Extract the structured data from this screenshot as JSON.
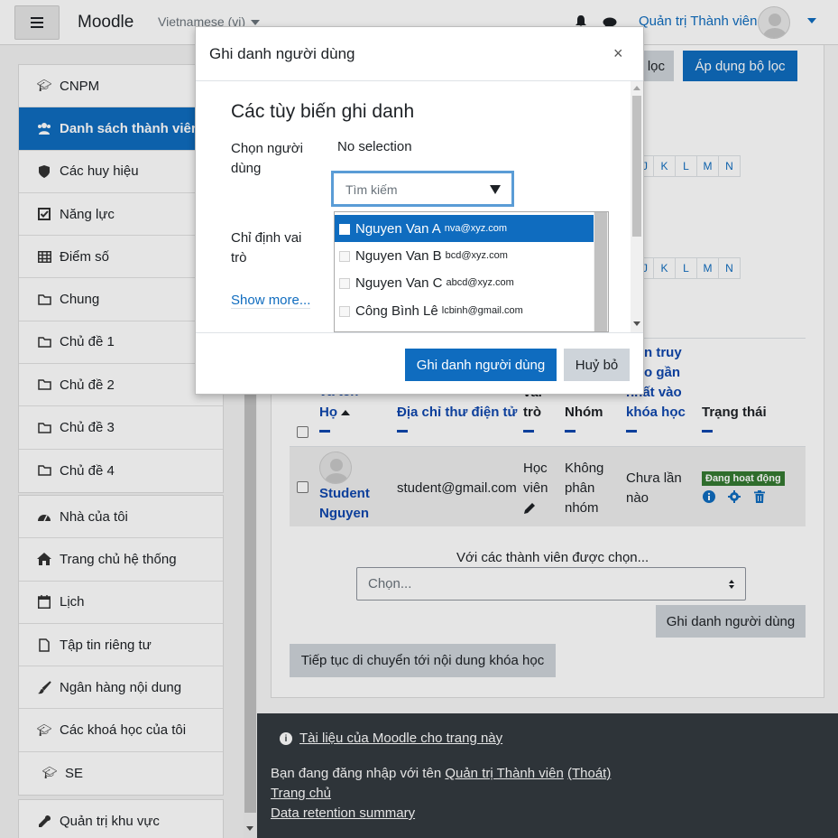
{
  "navbar": {
    "brand": "Moodle",
    "language": "Vietnamese (vi)",
    "user_name": "Quản trị Thành viên"
  },
  "sidebar": {
    "group1": [
      {
        "label": "CNPM",
        "icon": "graduation-cap-icon"
      },
      {
        "label": "Danh sách thành viên",
        "icon": "users-icon",
        "active": true
      },
      {
        "label": "Các huy hiệu",
        "icon": "shield-icon"
      },
      {
        "label": "Năng lực",
        "icon": "checkbox-icon"
      },
      {
        "label": "Điểm số",
        "icon": "table-icon"
      },
      {
        "label": "Chung",
        "icon": "folder-icon"
      },
      {
        "label": "Chủ đề 1",
        "icon": "folder-icon"
      },
      {
        "label": "Chủ đề 2",
        "icon": "folder-icon"
      },
      {
        "label": "Chủ đề 3",
        "icon": "folder-icon"
      },
      {
        "label": "Chủ đề 4",
        "icon": "folder-icon"
      }
    ],
    "group2": [
      {
        "label": "Nhà của tôi",
        "icon": "dashboard-icon"
      },
      {
        "label": "Trang chủ hệ thống",
        "icon": "home-icon"
      },
      {
        "label": "Lịch",
        "icon": "calendar-icon"
      },
      {
        "label": "Tập tin riêng tư",
        "icon": "file-icon"
      },
      {
        "label": "Ngân hàng nội dung",
        "icon": "paint-brush-icon"
      },
      {
        "label": "Các khoá học của tôi",
        "icon": "graduation-cap-icon"
      },
      {
        "label": "SE",
        "icon": "graduation-cap-icon"
      }
    ],
    "group3": [
      {
        "label": "Quản trị khu vực",
        "icon": "wrench-icon"
      }
    ]
  },
  "main": {
    "filter_button_partial": "lọc",
    "apply_filter_button": "Áp dụng bộ lọc",
    "letters_row1": [
      "K",
      "L",
      "M",
      "N"
    ],
    "letters_row2": [
      "K",
      "L",
      "M",
      "N"
    ],
    "letters_first_partial": "J",
    "columns": {
      "name_partial": "và tên",
      "surname": "Họ",
      "email": "Địa chỉ thư điện tử",
      "role_partial": "vai",
      "role": "trò",
      "group": "Nhóm",
      "last_access_partial1": "n truy",
      "last_access_partial2": "o gần",
      "last_access_line3": "nhất vào",
      "last_access_line4": "khóa học",
      "status": "Trạng thái"
    },
    "row": {
      "first_name": "Student",
      "last_name": "Nguyen",
      "email": "student@gmail.com",
      "role_line1": "Học",
      "role_line2": "viên",
      "group_line1": "Không",
      "group_line2": "phân",
      "group_line3": "nhóm",
      "last_access_line1": "Chưa lần",
      "last_access_line2": "nào",
      "status_badge": "Đang hoạt động"
    },
    "with_selected": "Với các thành viên được chọn...",
    "select_placeholder": "Chọn...",
    "enrol_button": "Ghi danh người dùng",
    "continue_button": "Tiếp tục di chuyển tới nội dung khóa học"
  },
  "footer": {
    "docs_link": "Tài liệu của Moodle cho trang này",
    "logged_in_prefix": "Bạn đang đăng nhập với tên",
    "logged_in_user": "Quản trị Thành viên",
    "logout": "(Thoát)",
    "home_link": "Trang chủ",
    "retention_link": "Data retention summary"
  },
  "modal": {
    "title": "Ghi danh người dùng",
    "close": "×",
    "section_title": "Các tùy biến ghi danh",
    "select_users_label_1": "Chọn người",
    "select_users_label_2": "dùng",
    "no_selection": "No selection",
    "search_placeholder": "Tìm kiếm",
    "assign_role_label_1": "Chỉ định vai",
    "assign_role_label_2": "trò",
    "show_more": "Show more...",
    "suggestions": [
      {
        "name": "Nguyen Van A",
        "email": "nva@xyz.com",
        "selected": true
      },
      {
        "name": "Nguyen Van B",
        "email": "bcd@xyz.com"
      },
      {
        "name": "Nguyen Van C",
        "email": "abcd@xyz.com"
      },
      {
        "name": "Công Bình Lê",
        "email": "lcbinh@gmail.com"
      }
    ],
    "enrol_button": "Ghi danh người dùng",
    "cancel_button": "Huỷ bỏ"
  },
  "colors": {
    "primary": "#0f6cbf",
    "badge_active": "#357a32",
    "footer_bg": "#343a40"
  }
}
